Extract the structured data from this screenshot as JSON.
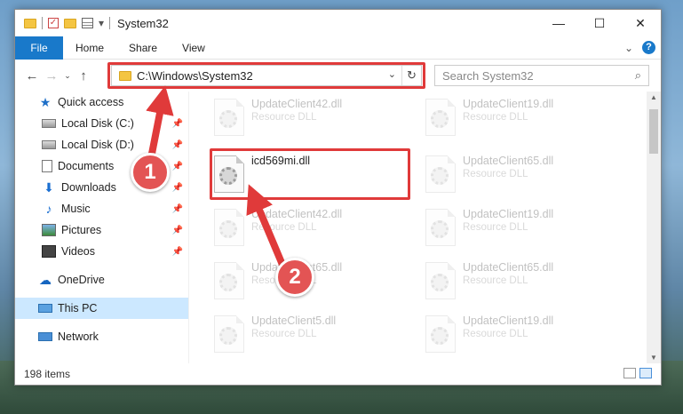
{
  "window": {
    "title": "System32",
    "minimize": "—",
    "maximize": "☐",
    "close": "✕"
  },
  "ribbon": {
    "tabs": [
      "File",
      "Home",
      "Share",
      "View"
    ],
    "expand": "⌄",
    "help": "?"
  },
  "nav": {
    "back": "←",
    "forward": "→",
    "recent": "⌄",
    "up": "↑"
  },
  "address": {
    "path": "C:\\Windows\\System32",
    "dropdown": "⌄",
    "refresh": "↻"
  },
  "search": {
    "placeholder": "Search System32",
    "icon": "⌕"
  },
  "sidebar": {
    "items": [
      {
        "label": "Quick access",
        "icon": "star-icon"
      },
      {
        "label": "Local Disk (C:)",
        "icon": "drive-icon",
        "pinned": true
      },
      {
        "label": "Local Disk (D:)",
        "icon": "drive-icon",
        "pinned": true
      },
      {
        "label": "Documents",
        "icon": "documents-icon",
        "pinned": true
      },
      {
        "label": "Downloads",
        "icon": "download-icon",
        "pinned": true
      },
      {
        "label": "Music",
        "icon": "music-icon",
        "pinned": true
      },
      {
        "label": "Pictures",
        "icon": "pictures-icon",
        "pinned": true
      },
      {
        "label": "Videos",
        "icon": "videos-icon",
        "pinned": true
      },
      {
        "label": "OneDrive",
        "icon": "cloud-icon"
      },
      {
        "label": "This PC",
        "icon": "pc-icon",
        "selected": true
      },
      {
        "label": "Network",
        "icon": "network-icon"
      }
    ],
    "pin_glyph": "📌"
  },
  "files": [
    {
      "name": "UpdateClient42.dll",
      "type": "Resource DLL",
      "faded": true
    },
    {
      "name": "UpdateClient19.dll",
      "type": "Resource DLL",
      "faded": true
    },
    {
      "name": "icd569mi.dll",
      "type": "",
      "faded": false,
      "highlighted": true
    },
    {
      "name": "UpdateClient65.dll",
      "type": "Resource DLL",
      "faded": true
    },
    {
      "name": "UpdateClient42.dll",
      "type": "Resource DLL",
      "faded": true
    },
    {
      "name": "UpdateClient19.dll",
      "type": "Resource DLL",
      "faded": true
    },
    {
      "name": "UpdateClient65.dll",
      "type": "Resource DLL",
      "faded": true
    },
    {
      "name": "UpdateClient65.dll",
      "type": "Resource DLL",
      "faded": true
    },
    {
      "name": "UpdateClient5.dll",
      "type": "Resource DLL",
      "faded": true
    },
    {
      "name": "UpdateClient19.dll",
      "type": "Resource DLL",
      "faded": true
    }
  ],
  "status": {
    "count": "198 items"
  },
  "callouts": {
    "one": "1",
    "two": "2",
    "color": "#e03a3a"
  }
}
